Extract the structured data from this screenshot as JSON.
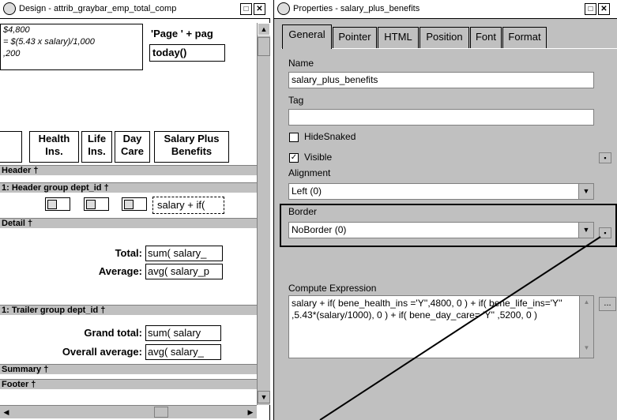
{
  "design": {
    "title": "Design - attrib_graybar_emp_total_comp",
    "top_fields": {
      "line1": "$4,800",
      "line2": "= $(5.43 x salary)/1,000",
      "line3": ",200",
      "page_expr": "'Page ' + pag",
      "today": "today()"
    },
    "headers": {
      "health": "Health Ins.",
      "life": "Life Ins.",
      "day": "Day Care",
      "salary": "Salary Plus Benefits"
    },
    "bands": {
      "header": "Header †",
      "group_header": "1: Header group dept_id †",
      "detail": "Detail †",
      "trailer": "1: Trailer group dept_id †",
      "summary": "Summary †",
      "footer": "Footer †"
    },
    "group_compute": "salary + if(",
    "detail_rows": [
      {
        "label": "Total:",
        "value": "sum( salary_"
      },
      {
        "label": "Average:",
        "value": "avg( salary_p"
      }
    ],
    "trailer_rows": [
      {
        "label": "Grand total:",
        "value": "sum( salary"
      },
      {
        "label": "Overall average:",
        "value": "avg( salary_"
      }
    ]
  },
  "properties": {
    "title": "Properties - salary_plus_benefits",
    "tabs": [
      "General",
      "Pointer",
      "HTML",
      "Position",
      "Font",
      "Format"
    ],
    "name_label": "Name",
    "name_value": "salary_plus_benefits",
    "tag_label": "Tag",
    "tag_value": "",
    "hidesnaked_label": "HideSnaked",
    "visible_label": "Visible",
    "alignment_label": "Alignment",
    "alignment_value": "Left (0)",
    "border_label": "Border",
    "border_value": "NoBorder (0)",
    "compute_label": "Compute Expression",
    "compute_value": "salary + if( bene_health_ins ='Y'',4800, 0 ) + if( bene_life_ins='Y'' ,5.43*(salary/1000), 0 ) + if( bene_day_care= 'Y'' ,5200, 0 )",
    "more_button": "..."
  },
  "icons": {
    "window": "datawindow-icon",
    "maximize": "maximize-icon",
    "close": "close-icon"
  }
}
